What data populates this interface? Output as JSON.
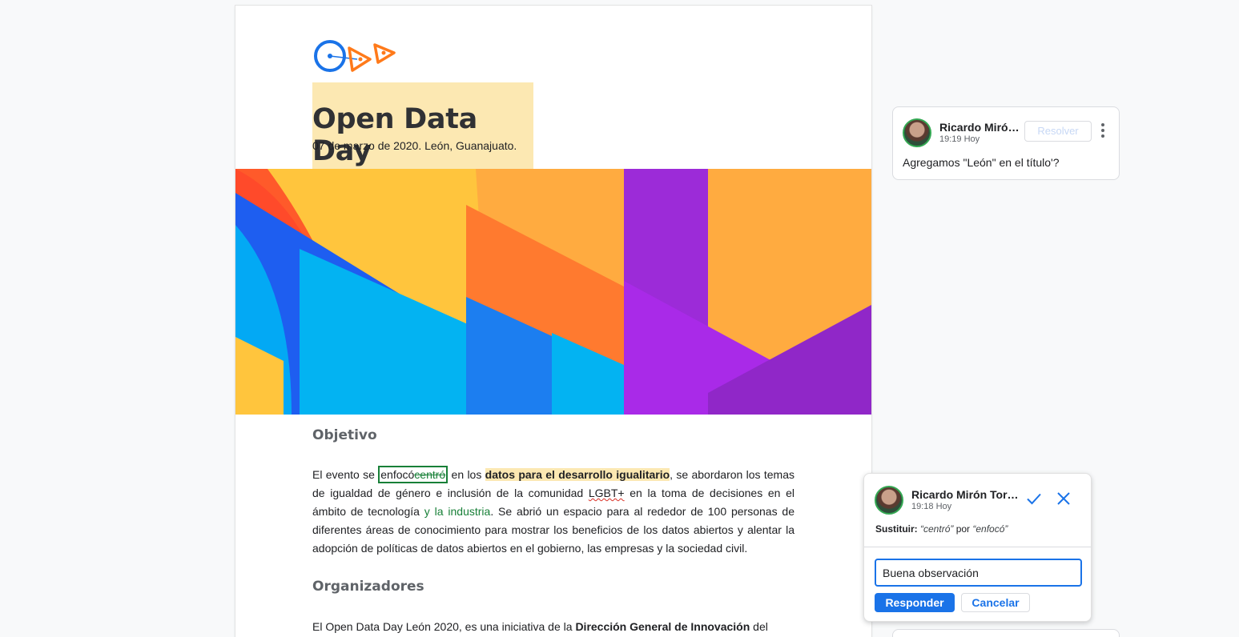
{
  "document": {
    "title": "Open Data Day",
    "subtitle": "07 de marzo de 2020. León, Guanajuato.",
    "section1_heading": "Objetivo",
    "section1_text": {
      "t1": "El evento se ",
      "inserted": "enfocó",
      "deleted": "centró",
      "t2": " en los ",
      "highlighted": "datos para el desarrollo igualitario",
      "t3": ", se abordaron los temas de igualdad de género e inclusión de la comunidad ",
      "misspelled": "LGBT+",
      "t4": " en la toma de decisiones en el ámbito de tecnología ",
      "green_insert": "y la industria",
      "t5": ". Se abrió un espacio para al rededor de 100 personas de diferentes áreas de conocimiento para mostrar los beneficios de los datos abiertos y alentar la adopción de políticas de datos abiertos en el gobierno, las empresas y la sociedad civil."
    },
    "section2_heading": "Organizadores",
    "section2_text": {
      "t1": "El Open Data Day León 2020, es una iniciativa de la ",
      "bold": "Dirección General de Innovación",
      "t2": " del"
    }
  },
  "comment1": {
    "author": "Ricardo Miró…",
    "time": "19:19 Hoy",
    "resolve_label": "Resolver",
    "text": "Agregamos \"León\" en el título'?"
  },
  "comment2": {
    "author": "Ricardo Mirón Tor…",
    "time": "19:18 Hoy",
    "suggest_label": "Sustituir:",
    "suggest_from": "“centró”",
    "suggest_by": " por ",
    "suggest_to": "“enfocó”",
    "reply_value": "Buena observación",
    "reply_button": "Responder",
    "cancel_button": "Cancelar"
  },
  "colors": {
    "accent": "#1a73e8",
    "suggestion_green": "#188038",
    "highlight": "#fce8b2"
  },
  "icons": [
    "odd-logo",
    "more-vert-icon",
    "check-icon",
    "close-icon",
    "avatar"
  ]
}
